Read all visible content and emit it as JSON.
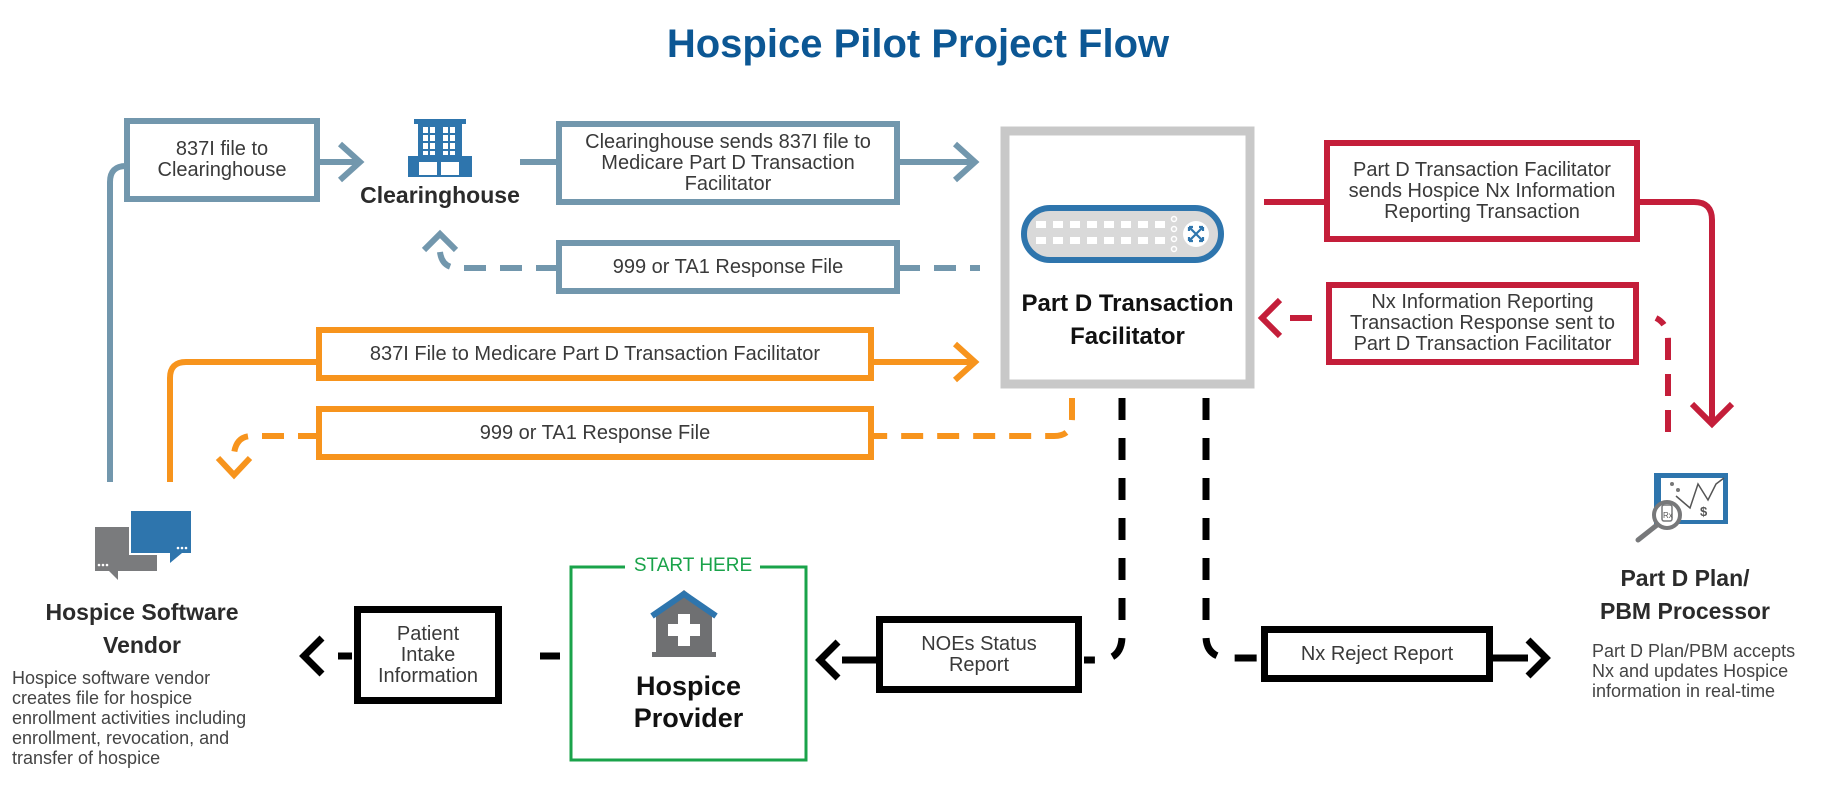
{
  "title": "Hospice Pilot Project Flow",
  "colors": {
    "title": "#0c5794",
    "clearinghouse_path": "#7297ad",
    "direct_path": "#f7941d",
    "plan_path": "#c41e3a",
    "provider_path": "#000000",
    "start_here": "#1aa34a",
    "facilitator_border": "#c8c8c8",
    "icon_blue": "#2e75ad",
    "icon_gray": "#7a7b7d"
  },
  "nodes": {
    "clearinghouse": {
      "label": "Clearinghouse",
      "icon": "building-icon"
    },
    "facilitator": {
      "label": "Part D Transaction\nFacilitator",
      "icon": "network-switch-icon"
    },
    "vendor": {
      "label": "Hospice Software\nVendor",
      "icon": "chat-bubbles-icon",
      "description": "Hospice software vendor\ncreates file for hospice\nenrollment activities including\nenrollment, revocation, and\ntransfer of hospice"
    },
    "provider": {
      "start_label": "START HERE",
      "label": "Hospice\nProvider",
      "icon": "hospital-house-icon"
    },
    "plan": {
      "label": "Part D Plan/\nPBM Processor",
      "icon": "rx-analytics-icon",
      "description": "Part D Plan/PBM accepts\nNx and updates Hospice\ninformation in real-time"
    }
  },
  "steps": {
    "file_to_clearinghouse": "837I file to\nClearinghouse",
    "clearinghouse_sends": "Clearinghouse sends 837I file to\nMedicare Part D Transaction\nFacilitator",
    "clearinghouse_response": "999 or TA1 Response File",
    "file_to_facilitator": "837I File to Medicare Part D Transaction Facilitator",
    "facilitator_response": "999 or TA1 Response File",
    "facilitator_sends_nx": "Part D Transaction Facilitator\nsends Hospice Nx Information\nReporting Transaction",
    "nx_response": "Nx Information Reporting\nTransaction Response sent to\nPart D Transaction Facilitator",
    "patient_intake": "Patient\nIntake\nInformation",
    "noes_status": "NOEs Status\nReport",
    "nx_reject": "Nx Reject Report"
  }
}
